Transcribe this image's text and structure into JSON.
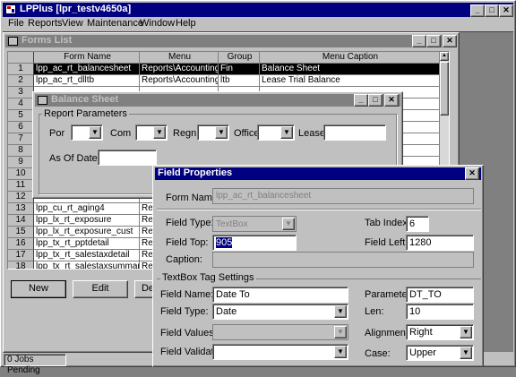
{
  "app": {
    "title": "LPPlus  [lpr_testv4650a]",
    "menu": [
      "File",
      "Reports",
      "View",
      "Maintenance",
      "Window",
      "Help"
    ]
  },
  "forms_list": {
    "title": "Forms List",
    "columns": [
      "Form Name",
      "Menu",
      "Group",
      "Menu Caption"
    ],
    "rows": [
      {
        "num": "1",
        "name": "lpp_ac_rt_balancesheet",
        "menu": "Reports\\Accounting",
        "group": "Fin",
        "caption": "Balance Sheet"
      },
      {
        "num": "2",
        "name": "lpp_ac_rt_dlltb",
        "menu": "Reports\\Accounting",
        "group": "ltb",
        "caption": "Lease Trial Balance"
      },
      {
        "num": "3",
        "name": "",
        "menu": "",
        "group": "",
        "caption": ""
      },
      {
        "num": "4",
        "name": "",
        "menu": "",
        "group": "",
        "caption": ""
      },
      {
        "num": "5",
        "name": "",
        "menu": "",
        "group": "",
        "caption": ""
      },
      {
        "num": "6",
        "name": "",
        "menu": "",
        "group": "",
        "caption": ""
      },
      {
        "num": "7",
        "name": "",
        "menu": "",
        "group": "",
        "caption": ""
      },
      {
        "num": "8",
        "name": "",
        "menu": "",
        "group": "",
        "caption": ""
      },
      {
        "num": "9",
        "name": "",
        "menu": "",
        "group": "",
        "caption": ""
      },
      {
        "num": "10",
        "name": "",
        "menu": "",
        "group": "",
        "caption": ""
      },
      {
        "num": "11",
        "name": "",
        "menu": "",
        "group": "",
        "caption": ""
      },
      {
        "num": "12",
        "name": "",
        "menu": "",
        "group": "",
        "caption": ""
      },
      {
        "num": "13",
        "name": "lpp_cu_rt_aging4",
        "menu": "Re",
        "group": "",
        "caption": ""
      },
      {
        "num": "14",
        "name": "lpp_lx_rt_exposure",
        "menu": "Re",
        "group": "",
        "caption": ""
      },
      {
        "num": "15",
        "name": "lpp_lx_rt_exposure_cust",
        "menu": "Re",
        "group": "",
        "caption": ""
      },
      {
        "num": "16",
        "name": "lpp_tx_rt_pptdetail",
        "menu": "Re",
        "group": "",
        "caption": ""
      },
      {
        "num": "17",
        "name": "lpp_tx_rt_salestaxdetail",
        "menu": "Re",
        "group": "",
        "caption": ""
      },
      {
        "num": "18",
        "name": "lpp_tx_rt_salestaxsummary",
        "menu": "Re",
        "group": "",
        "caption": ""
      }
    ],
    "buttons": {
      "new": "New",
      "edit": "Edit",
      "delete": "De"
    }
  },
  "balance_sheet": {
    "title": "Balance Sheet",
    "group_label": "Report Parameters",
    "labels": {
      "por": "Por",
      "com": "Com",
      "regn": "Regn",
      "office": "Office",
      "lease": "Lease",
      "as_of_date": "As Of Date"
    }
  },
  "field_properties": {
    "title": "Field Properties",
    "form_name_label": "Form Name:",
    "form_name_value": "lpp_ac_rt_balancesheet",
    "field_type_label": "Field Type:",
    "field_type_value": "TextBox",
    "tab_index_label": "Tab Index:",
    "tab_index_value": "6",
    "field_top_label": "Field Top:",
    "field_top_value": "905",
    "field_left_label": "Field Left:",
    "field_left_value": "1280",
    "caption_label": "Caption:",
    "caption_value": "",
    "tag_group_label": "TextBox Tag Settings",
    "field_name_label": "Field Name:",
    "field_name_value": "Date To",
    "parameter_label": "Parameter:",
    "parameter_value": "DT_TO",
    "tag_field_type_label": "Field Type:",
    "tag_field_type_value": "Date",
    "len_label": "Len:",
    "len_value": "10",
    "field_values_label": "Field Values:",
    "field_values_value": "",
    "alignment_label": "Alignment:",
    "alignment_value": "Right",
    "field_validate_label": "Field Validate:",
    "field_validate_value": "",
    "case_label": "Case:",
    "case_value": "Upper"
  },
  "status": {
    "jobs": "0 Jobs Pending"
  },
  "colors": {
    "titlebar_active": "#000080",
    "face": "#c0c0c0",
    "desktop": "#808080"
  }
}
